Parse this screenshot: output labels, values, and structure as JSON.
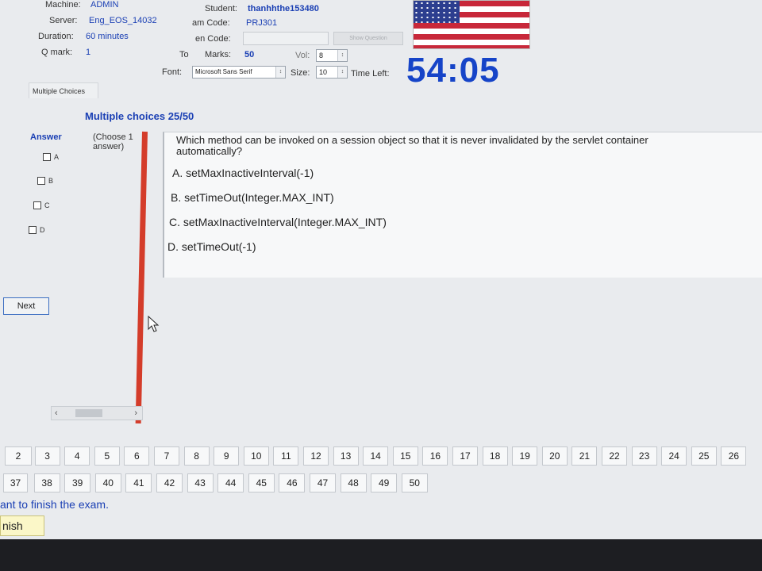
{
  "header": {
    "machine_label": "Machine:",
    "machine_value": "ADMIN",
    "server_label": "Server:",
    "server_value": "Eng_EOS_14032",
    "duration_label": "Duration:",
    "duration_value": "60 minutes",
    "qmark_label": "Q mark:",
    "qmark_value": "1",
    "student_label": "Student:",
    "student_value": "thanhhthe153480",
    "exam_code_label": "am Code:",
    "exam_code_value": "PRJ301",
    "open_code_label": "en Code:",
    "show_question_label": "Show Question",
    "total_marks_label": "Marks:",
    "total_marks_value": "50",
    "total_marks_prefix": "To",
    "vol_label": "Vol:",
    "vol_value": "8",
    "font_label": "Font:",
    "font_value": "Microsoft Sans Serif",
    "size_label": "Size:",
    "size_value": "10",
    "time_left_label": "Time Left:",
    "time_left_value": "54:05"
  },
  "tab": {
    "label": "Multiple Choices"
  },
  "section_title": "Multiple choices 25/50",
  "answer_panel": {
    "header": "Answer",
    "hint": "(Choose 1 answer)",
    "choices": [
      "A",
      "B",
      "C",
      "D"
    ]
  },
  "question": {
    "text": "Which method can be invoked on a session object so that it is never invalidated by the servlet container automatically?",
    "options": [
      "A. setMaxInactiveInterval(-1)",
      "B. setTimeOut(Integer.MAX_INT)",
      "C. setMaxInactiveInterval(Integer.MAX_INT)",
      "D. setTimeOut(-1)"
    ]
  },
  "next_label": "Next",
  "nav_row1": [
    "2",
    "3",
    "4",
    "5",
    "6",
    "7",
    "8",
    "9",
    "10",
    "11",
    "12",
    "13",
    "14",
    "15",
    "16",
    "17",
    "18",
    "19",
    "20",
    "21",
    "22",
    "23",
    "24",
    "25",
    "26"
  ],
  "nav_row2": [
    "37",
    "38",
    "39",
    "40",
    "41",
    "42",
    "43",
    "44",
    "45",
    "46",
    "47",
    "48",
    "49",
    "50"
  ],
  "finish_note": "ant to finish the exam.",
  "finish_label": "nish",
  "icons": {
    "flag": "us-flag-icon",
    "scroll_left": "chevron-left-icon",
    "scroll_right": "chevron-right-icon",
    "cursor": "mouse-cursor-icon"
  }
}
